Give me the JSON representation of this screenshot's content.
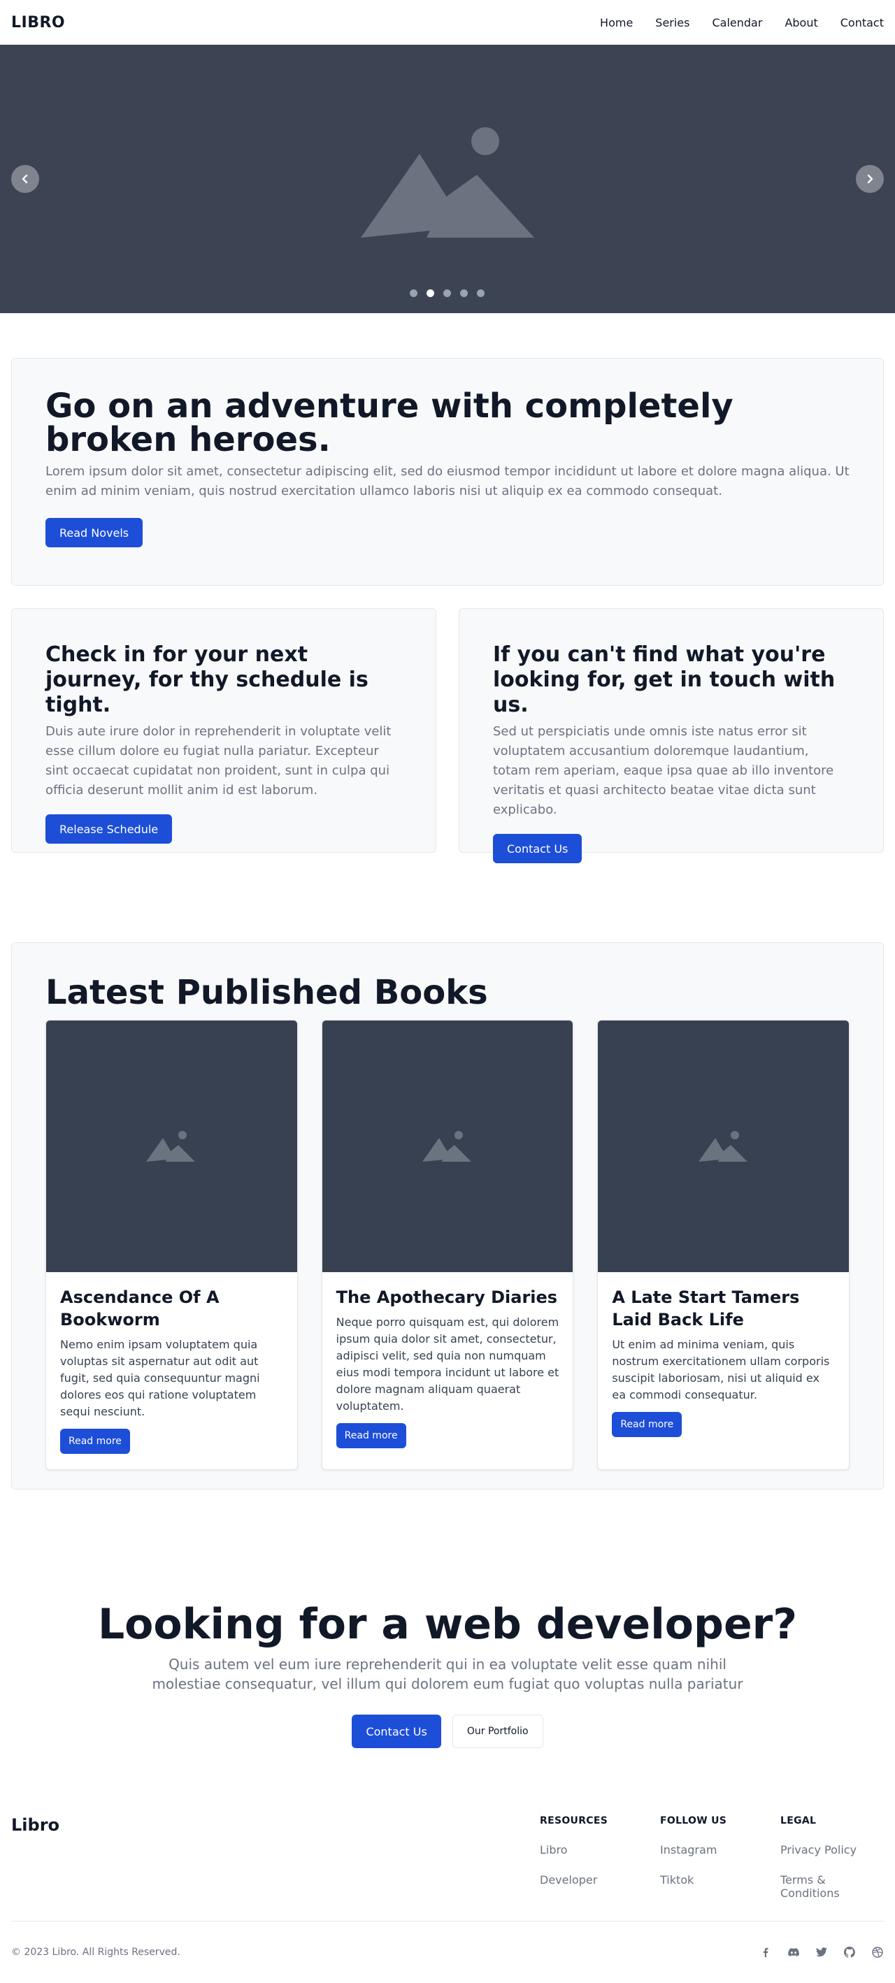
{
  "nav": {
    "brand": "LIBRO",
    "links": [
      "Home",
      "Series",
      "Calendar",
      "About",
      "Contact"
    ]
  },
  "carousel": {
    "slide_count": 5,
    "active_slide": 2
  },
  "hero": {
    "title": "Go on an adventure with completely broken heroes.",
    "text": "Lorem ipsum dolor sit amet, consectetur adipiscing elit, sed do eiusmod tempor incididunt ut labore et dolore magna aliqua. Ut enim ad minim veniam, quis nostrud exercitation ullamco laboris nisi ut aliquip ex ea commodo consequat.",
    "button": "Read Novels"
  },
  "schedule": {
    "title": "Check in for your next journey, for thy schedule is tight.",
    "text": "Duis aute irure dolor in reprehenderit in voluptate velit esse cillum dolore eu fugiat nulla pariatur. Excepteur sint occaecat cupidatat non proident, sunt in culpa qui officia deserunt mollit anim id est laborum.",
    "button": "Release Schedule"
  },
  "contact_card": {
    "title": "If you can't find what you're looking for, get in touch with us.",
    "text": "Sed ut perspiciatis unde omnis iste natus error sit voluptatem accusantium doloremque laudantium, totam rem aperiam, eaque ipsa quae ab illo inventore veritatis et quasi architecto beatae vitae dicta sunt explicabo.",
    "button": "Contact Us"
  },
  "books": {
    "heading": "Latest Published Books",
    "items": [
      {
        "title": "Ascendance Of A Bookworm",
        "desc": "Nemo enim ipsam voluptatem quia voluptas sit aspernatur aut odit aut fugit, sed quia consequuntur magni dolores eos qui ratione voluptatem sequi nesciunt.",
        "button": "Read more"
      },
      {
        "title": "The Apothecary Diaries",
        "desc": "Neque porro quisquam est, qui dolorem ipsum quia dolor sit amet, consectetur, adipisci velit, sed quia non numquam eius modi tempora incidunt ut labore et dolore magnam aliquam quaerat voluptatem.",
        "button": "Read more"
      },
      {
        "title": "A Late Start Tamers Laid Back Life",
        "desc": "Ut enim ad minima veniam, quis nostrum exercitationem ullam corporis suscipit laboriosam, nisi ut aliquid ex ea commodi consequatur.",
        "button": "Read more"
      }
    ]
  },
  "cta": {
    "title": "Looking for a web developer?",
    "text": "Quis autem vel eum iure reprehenderit qui in ea voluptate velit esse quam nihil molestiae consequatur, vel illum qui dolorem eum fugiat quo voluptas nulla pariatur",
    "primary": "Contact Us",
    "secondary": "Our Portfolio"
  },
  "footer": {
    "brand": "Libro",
    "columns": [
      {
        "heading": "RESOURCES",
        "links": [
          "Libro",
          "Developer"
        ]
      },
      {
        "heading": "FOLLOW US",
        "links": [
          "Instagram",
          "Tiktok"
        ]
      },
      {
        "heading": "LEGAL",
        "links": [
          "Privacy Policy",
          "Terms & Conditions"
        ]
      }
    ],
    "copyright": "© 2023 Libro. All Rights Reserved.",
    "socials": [
      "facebook-icon",
      "discord-icon",
      "twitter-icon",
      "github-icon",
      "dribbble-icon"
    ]
  },
  "colors": {
    "primary": "#1d4ed8",
    "hero_bg": "#3c4353",
    "card_bg": "#f8f9fb",
    "book_image_bg": "#374151"
  }
}
